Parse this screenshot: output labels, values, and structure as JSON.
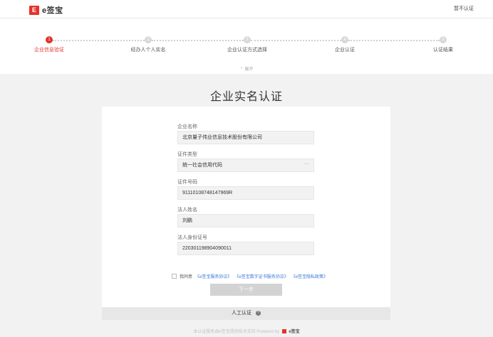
{
  "header": {
    "logo_mark": "E",
    "logo_text": "e签宝",
    "skip_label": "暂不认证"
  },
  "steps": [
    {
      "num": "1",
      "label": "企业信息验证"
    },
    {
      "num": "2",
      "label": "经办人个人实名"
    },
    {
      "num": "3",
      "label": "企业认证方式选择"
    },
    {
      "num": "4",
      "label": "企业认证"
    },
    {
      "num": "5",
      "label": "认证结果"
    }
  ],
  "collapse_label": "⌃ 展开",
  "page_title": "企业实名认证",
  "form": {
    "company_name": {
      "label": "企业名称",
      "value": "北京量子伟业信息技术股份有限公司"
    },
    "cert_type": {
      "label": "证件类型",
      "value": "统一社会信用代码"
    },
    "cert_number": {
      "label": "证件号码",
      "value": "91110108748147969R"
    },
    "legal_name": {
      "label": "法人姓名",
      "value": "刘鹏"
    },
    "legal_id": {
      "label": "法人身份证号",
      "value": "220301198904090011"
    }
  },
  "agreement": {
    "prefix": "我同意",
    "link1": "《e签宝服务协议》",
    "link2": "《e签宝数字证书服务协议》",
    "link3": "《e签宝隐私政策》"
  },
  "next_label": "下一步",
  "manual": {
    "label": "人工认证",
    "icon": "?"
  },
  "footer": {
    "text": "本认证服务由e签宝提供技术支持 Powered by",
    "brand": "e签宝"
  }
}
